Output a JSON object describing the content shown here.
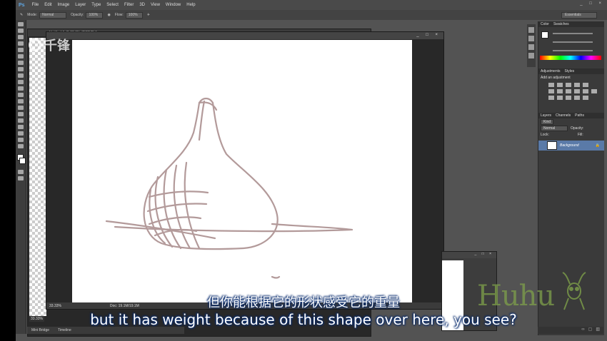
{
  "app": {
    "logo": "Ps",
    "menu": [
      "File",
      "Edit",
      "Image",
      "Layer",
      "Type",
      "Select",
      "Filter",
      "3D",
      "View",
      "Window",
      "Help"
    ],
    "window_buttons": "_ □ ×"
  },
  "options_bar": {
    "mode_label": "Mode:",
    "mode_value": "Normal",
    "opacity_label": "Opacity:",
    "opacity_value": "100%",
    "flow_label": "Flow:",
    "flow_value": "100%",
    "workspace": "Essentials"
  },
  "back_document": {
    "tab": "Untitled-1 @ 33.3% (RGB/8) *",
    "zoom": "33.33%"
  },
  "front_document": {
    "tab": "Untitled-1 @ 33.3% (RGB/8) *",
    "status_zoom": "33.33%",
    "status_doc": "Doc: 19.1M/19.1M",
    "window_buttons": "_ □ ×"
  },
  "mini_bridge": {
    "tabs": [
      "Mini Bridge",
      "Timeline"
    ]
  },
  "panels": {
    "color_tab": "Color",
    "swatches_tab": "Swatches",
    "adjustments_tab": "Adjustments",
    "styles_tab": "Styles",
    "add_adjustment": "Add an adjustment",
    "layers_tab": "Layers",
    "channels_tab": "Channels",
    "paths_tab": "Paths",
    "kind": "Kind",
    "blend_mode": "Normal",
    "opacity_label": "Opacity:",
    "lock_label": "Lock:",
    "fill_label": "Fill:",
    "layer_name": "Background"
  },
  "watermark": {
    "brand": "千锋"
  },
  "logo": {
    "text": "Huhu"
  },
  "subtitles": {
    "cn": "但你能根据它的形状感受它的重量",
    "en": "but it has weight because of this shape over here, you see?"
  }
}
